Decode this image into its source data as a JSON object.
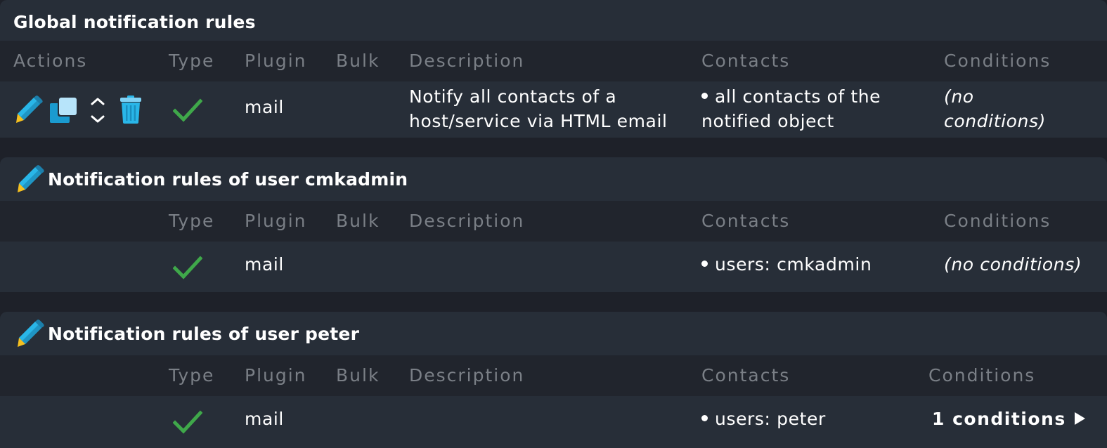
{
  "colors": {
    "page_bg": "#1e2129",
    "panel_bg": "#272e38",
    "header_bg": "#21252d",
    "header_text": "#7a7f86",
    "text": "#ffffff",
    "check_green": "#3fa84a",
    "icon_blue": "#29b6e8",
    "pencil_tip": "#f5c020"
  },
  "columns": {
    "actions": "Actions",
    "type": "Type",
    "plugin": "Plugin",
    "bulk": "Bulk",
    "description": "Description",
    "contacts": "Contacts",
    "conditions": "Conditions"
  },
  "sections": [
    {
      "title": "Global notification rules",
      "rules": [
        {
          "actions": [
            "edit-icon",
            "clone-icon",
            "move-icon",
            "delete-icon"
          ],
          "type_icon": "checkmark-icon",
          "plugin": "mail",
          "bulk": "",
          "description_line1": "Notify all contacts of a",
          "description_line2": "host/service via HTML email",
          "contacts_line1": "all contacts of the",
          "contacts_line2": "notified object",
          "conditions_line1": "(no",
          "conditions_line2": "conditions)"
        }
      ]
    },
    {
      "title": "Notification rules of user cmkadmin",
      "title_icon": "edit-icon",
      "rules": [
        {
          "type_icon": "checkmark-icon",
          "plugin": "mail",
          "bulk": "",
          "description": "",
          "contacts": "users: cmkadmin",
          "conditions": "(no conditions)"
        }
      ]
    },
    {
      "title": "Notification rules of user peter",
      "title_icon": "edit-icon",
      "rules": [
        {
          "type_icon": "checkmark-icon",
          "plugin": "mail",
          "bulk": "",
          "description": "",
          "contacts": "users: peter",
          "conditions": "1 conditions"
        }
      ]
    }
  ]
}
